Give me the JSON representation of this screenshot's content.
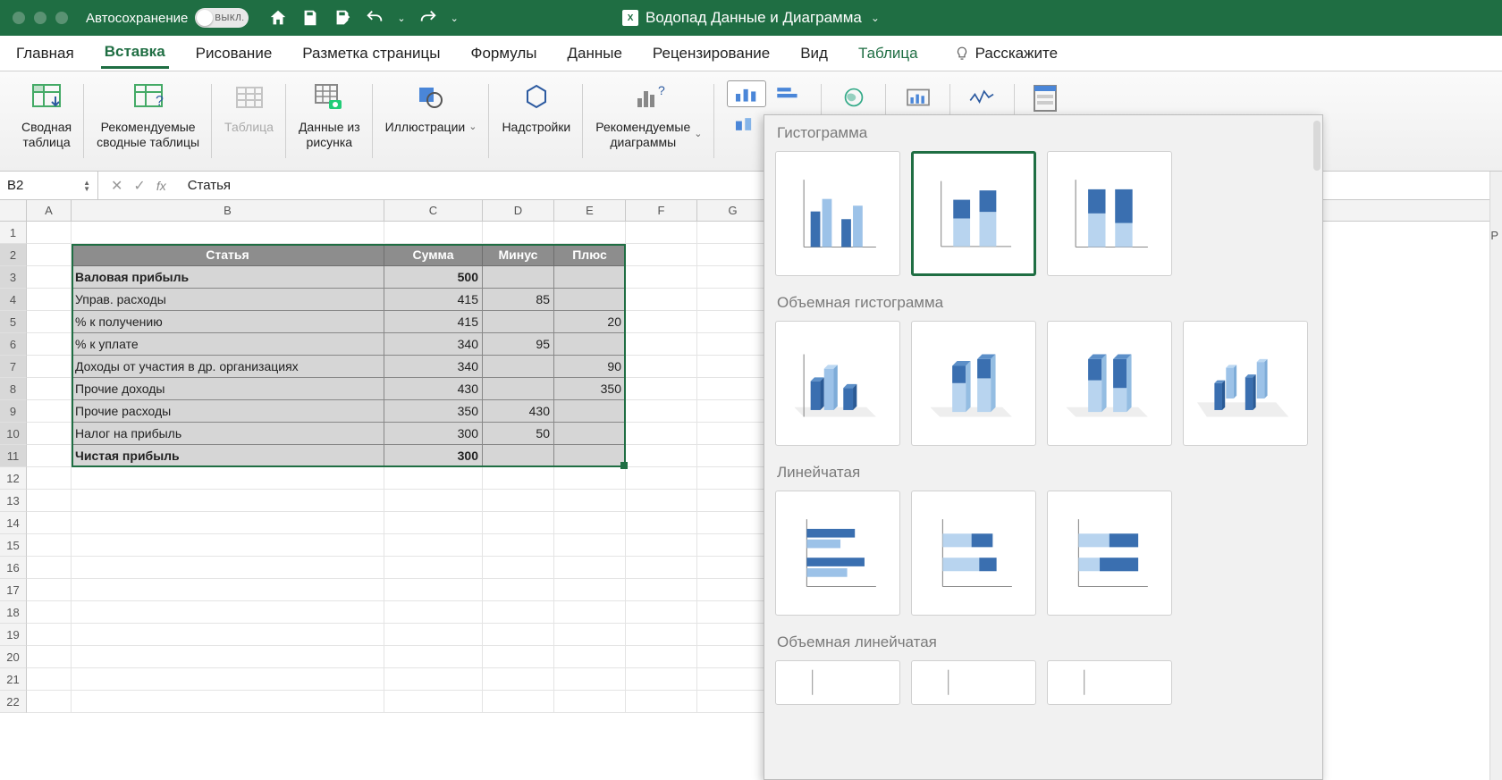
{
  "titlebar": {
    "autosave_label": "Автосохранение",
    "autosave_toggle": "ВЫКЛ.",
    "document_name": "Водопад Данные и Диаграмма"
  },
  "ribbon_tabs": {
    "home": "Главная",
    "insert": "Вставка",
    "draw": "Рисование",
    "page_layout": "Разметка страницы",
    "formulas": "Формулы",
    "data": "Данные",
    "review": "Рецензирование",
    "view": "Вид",
    "table": "Таблица",
    "tell_me": "Расскажите"
  },
  "ribbon": {
    "pivot_table": "Сводная\nтаблица",
    "recommended_pivot": "Рекомендуемые\nсводные таблицы",
    "table": "Таблица",
    "data_from_picture": "Данные из\nрисунка",
    "illustrations": "Иллюстрации",
    "addins": "Надстройки",
    "recommended_charts": "Рекомендуемые\nдиаграммы",
    "slicer": "Срез"
  },
  "formula_bar": {
    "name_box": "B2",
    "value": "Статья"
  },
  "columns": [
    "A",
    "B",
    "C",
    "D",
    "E",
    "F",
    "G"
  ],
  "table": {
    "headers": {
      "b": "Статья",
      "c": "Сумма",
      "d": "Минус",
      "e": "Плюс"
    },
    "rows": [
      {
        "b": "Валовая прибыль",
        "c": "500",
        "d": "",
        "e": "",
        "bold": true
      },
      {
        "b": "Управ. расходы",
        "c": "415",
        "d": "85",
        "e": ""
      },
      {
        "b": "% к получению",
        "c": "415",
        "d": "",
        "e": "20"
      },
      {
        "b": "% к уплате",
        "c": "340",
        "d": "95",
        "e": ""
      },
      {
        "b": "Доходы от участия в др. организациях",
        "c": "340",
        "d": "",
        "e": "90"
      },
      {
        "b": "Прочие доходы",
        "c": "430",
        "d": "",
        "e": "350"
      },
      {
        "b": "Прочие расходы",
        "c": "350",
        "d": "430",
        "e": ""
      },
      {
        "b": "Налог на прибыль",
        "c": "300",
        "d": "50",
        "e": ""
      },
      {
        "b": "Чистая прибыль",
        "c": "300",
        "d": "",
        "e": "",
        "bold": true
      }
    ]
  },
  "chart_panel": {
    "histogram": "Гистограмма",
    "histogram_3d": "Объемная гистограмма",
    "bar": "Линейчатая",
    "bar_3d": "Объемная линейчатая"
  },
  "right_letter": "P"
}
